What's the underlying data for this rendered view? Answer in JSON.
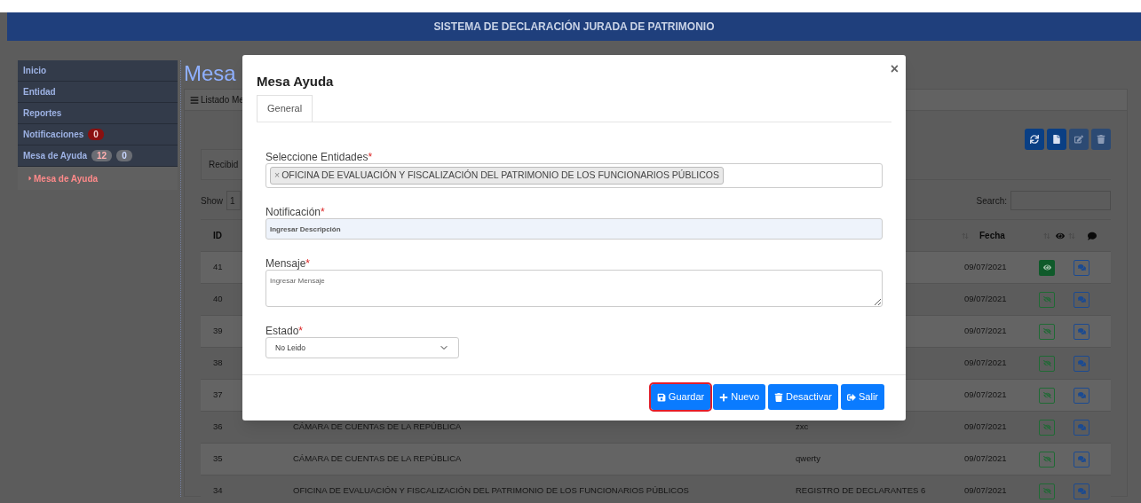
{
  "header": {
    "title": "SISTEMA DE DECLARACIÓN JURADA DE PATRIMONIO"
  },
  "sidebar": {
    "items": [
      {
        "label": "Inicio"
      },
      {
        "label": "Entidad"
      },
      {
        "label": "Reportes"
      },
      {
        "label": "Notificaciones",
        "badges": [
          {
            "text": "0",
            "kind": "danger"
          }
        ]
      },
      {
        "label": "Mesa de Ayuda",
        "badges": [
          {
            "text": "12",
            "kind": "danger-light"
          },
          {
            "text": "0",
            "kind": "info-light"
          }
        ],
        "children": [
          {
            "label": "Mesa de Ayuda",
            "selected": true
          }
        ]
      }
    ]
  },
  "page": {
    "title": "Mesa",
    "panel_title": "Listado Me",
    "toolbar": [
      {
        "kind": "refresh",
        "disabled": false
      },
      {
        "kind": "new",
        "disabled": false
      },
      {
        "kind": "edit",
        "disabled": true
      },
      {
        "kind": "delete",
        "disabled": true
      }
    ],
    "tabs": [
      {
        "label": "Recibid",
        "selected": true
      }
    ],
    "show_label": "Show",
    "show_value": "1",
    "search_label": "Search:",
    "table": {
      "id_header": "ID",
      "date_header": "Fecha",
      "rows": [
        {
          "id": "41",
          "date": "09/07/2021",
          "seen": true
        },
        {
          "id": "40",
          "date": "09/07/2021",
          "seen": false
        },
        {
          "id": "39",
          "date": "09/07/2021",
          "seen": false
        },
        {
          "id": "38",
          "date": "09/07/2021",
          "seen": false
        },
        {
          "id": "37",
          "date": "09/07/2021",
          "seen": false
        },
        {
          "id": "36",
          "entity": "CÁMARA DE CUENTAS DE LA REPÚBLICA",
          "subject": "zxc",
          "date": "09/07/2021",
          "seen": false
        },
        {
          "id": "35",
          "entity": "CÁMARA DE CUENTAS DE LA REPÚBLICA",
          "subject": "qwerty",
          "date": "09/07/2021",
          "seen": false
        },
        {
          "id": "34",
          "entity": "OFICINA DE EVALUACIÓN Y FISCALIZACIÓN DEL PATRIMONIO DE LOS FUNCIONARIOS PÚBLICOS",
          "subject": "REGISTRO DE DECLARANTES 6",
          "date": "09/07/2021",
          "seen": false
        }
      ]
    }
  },
  "modal": {
    "title": "Mesa Ayuda",
    "close": "×",
    "tabs": [
      {
        "label": "General",
        "selected": true
      }
    ],
    "entities": {
      "label": "Seleccione Entidades",
      "mark": "*",
      "tags": [
        {
          "remove": "×",
          "text": "OFICINA DE EVALUACIÓN Y FISCALIZACIÓN DEL PATRIMONIO DE LOS FUNCIONARIOS PÚBLICOS"
        }
      ]
    },
    "notification": {
      "label": "Notificación",
      "mark": "*",
      "placeholder": "Ingresar Descripción"
    },
    "message": {
      "label": "Mensaje",
      "mark": "*",
      "placeholder": "Ingresar Mensaje"
    },
    "status": {
      "label": "Estado",
      "mark": "*",
      "value": "No Leido"
    },
    "buttons": [
      {
        "label": "Guardar",
        "kind": "save",
        "focused": true
      },
      {
        "label": "Nuevo",
        "kind": "new",
        "focused": false
      },
      {
        "label": "Desactivar",
        "kind": "deactivate",
        "focused": false
      },
      {
        "label": "Salir",
        "kind": "exit",
        "focused": false
      }
    ]
  }
}
